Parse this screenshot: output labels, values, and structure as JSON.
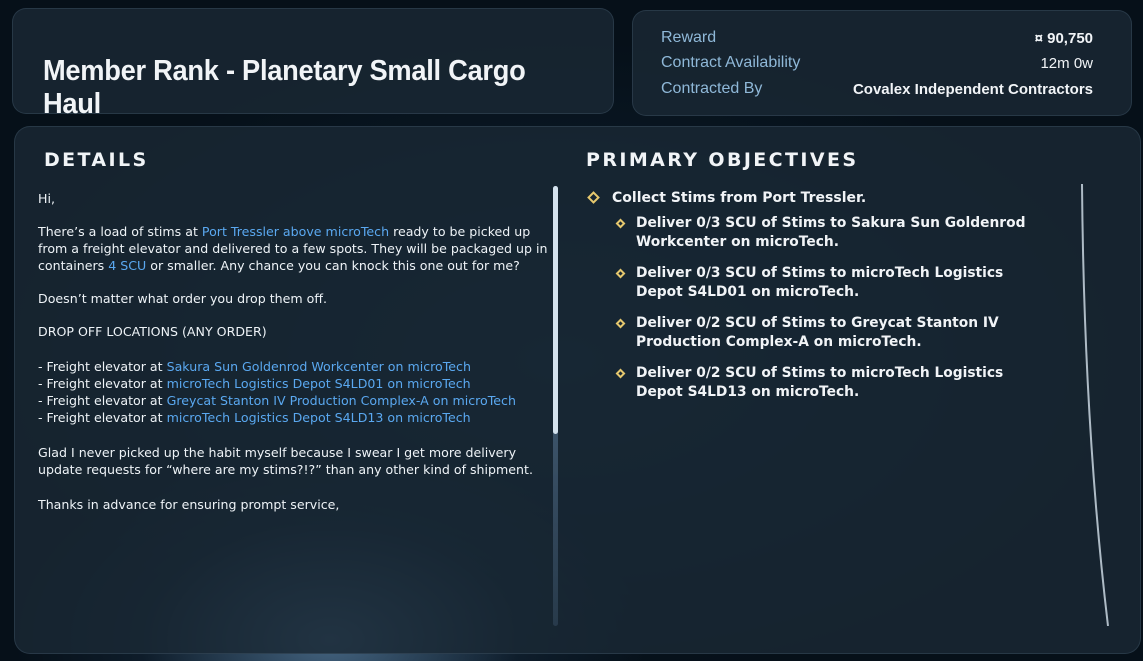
{
  "header": {
    "title": "Member Rank - Planetary Small Cargo Haul"
  },
  "info": {
    "reward_label": "Reward",
    "reward_value": "¤ 90,750",
    "availability_label": "Contract Availability",
    "availability_value": "12m 0w",
    "contracted_by_label": "Contracted By",
    "contracted_by_value": "Covalex Independent Contractors"
  },
  "details": {
    "heading": "DETAILS",
    "greeting": "Hi,",
    "p1_a": "There’s a load of stims at ",
    "p1_link1": "Port Tressler above microTech",
    "p1_b": " ready to be picked up from a freight elevator and delivered to a few spots. They will be packaged up in containers ",
    "p1_link2": "4 SCU",
    "p1_c": " or smaller. Any chance you can knock this one out for me?",
    "p2": "Doesn’t matter what order you drop them off.",
    "p3": "DROP OFF LOCATIONS (ANY ORDER)",
    "drop_prefix": "- Freight elevator at ",
    "drops": [
      "Sakura Sun Goldenrod Workcenter on microTech",
      "microTech Logistics Depot S4LD01 on microTech",
      "Greycat Stanton IV Production Complex-A on microTech",
      "microTech Logistics Depot S4LD13 on microTech"
    ],
    "p4": "Glad I never picked up the habit myself because I swear I get more delivery update requests for “where are my stims?!?” than any other kind of shipment.",
    "p5": "Thanks in advance for ensuring prompt service,"
  },
  "objectives": {
    "heading": "PRIMARY OBJECTIVES",
    "main": "Collect Stims from Port Tressler.",
    "subs": [
      "Deliver 0/3 SCU of Stims to Sakura Sun Goldenrod Workcenter on microTech.",
      "Deliver 0/3 SCU of Stims to microTech Logistics Depot S4LD01 on microTech.",
      "Deliver 0/2 SCU of Stims to Greycat Stanton IV Production Complex-A on microTech.",
      "Deliver 0/2 SCU of Stims to microTech Logistics Depot S4LD13 on microTech."
    ]
  },
  "colors": {
    "link": "#5aa8f0",
    "diamond": "#e6c86e",
    "label": "#8fb8d8"
  }
}
